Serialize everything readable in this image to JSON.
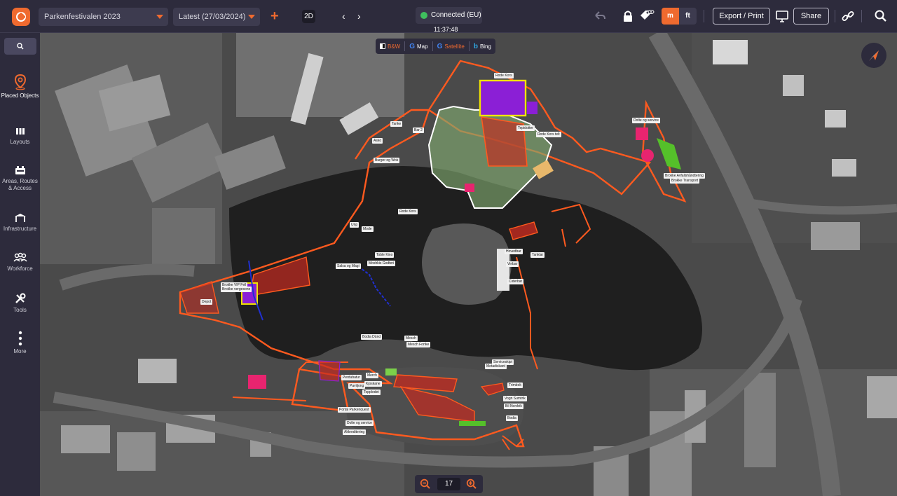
{
  "topbar": {
    "project_select": "Parkenfestivalen 2023",
    "version_select": "Latest (27/03/2024)",
    "view_mode": "2D",
    "connection_status": "Connected (EU)",
    "time": "11:37:48",
    "units": {
      "metric": "m",
      "imperial": "ft",
      "selected": "m"
    },
    "export_label": "Export / Print",
    "share_label": "Share"
  },
  "sidebar": {
    "items": [
      {
        "label": "Placed Objects",
        "icon": "map-pin-icon",
        "active": true
      },
      {
        "label": "Layouts",
        "icon": "layouts-icon"
      },
      {
        "label": "Areas, Routes & Access",
        "icon": "areas-icon"
      },
      {
        "label": "Infrastructure",
        "icon": "infrastructure-icon"
      },
      {
        "label": "Workforce",
        "icon": "workforce-icon"
      },
      {
        "label": "Tools",
        "icon": "tools-icon"
      },
      {
        "label": "More",
        "icon": "more-icon"
      }
    ]
  },
  "map_layers": [
    {
      "label": "B&W",
      "icon": "bw-layer-icon"
    },
    {
      "label": "Map",
      "icon": "google-icon"
    },
    {
      "label": "Satellite",
      "icon": "google-icon",
      "active": true
    },
    {
      "label": "Bing",
      "icon": "bing-icon"
    }
  ],
  "zoom": {
    "level": "17"
  },
  "map_labels": [
    "Rode Kors",
    "Tanke",
    "Bar 2",
    "Asko",
    "Burger og Wok",
    "Rode Kors telt",
    "Tepidotter",
    "Dolte og service",
    "Brokke Avfallshåndtering",
    "Brokke Transport",
    "Rode Kors",
    "Unp",
    "Mode",
    "Toble Kino",
    "Moshkis Godteri",
    "Salsa og Magi",
    "Hovedbar",
    "Tanklar",
    "Vinbar",
    "Ciderbar",
    "Brokke VIP Fell",
    "Brokke vergesone",
    "Depot",
    "Bodia Dünd",
    "Mesch",
    "Mesch Fortke",
    "Merch",
    "Perdubatur",
    "Toppledet",
    "Kjoskane",
    "Paviljong",
    "Portal Parkenquest",
    "Dolte og service",
    "Akkreditering",
    "Serviceskipt",
    "Metadiskant",
    "Trimbok",
    "Vogn Sumtrik",
    "Bil Nordvik",
    "Bodia"
  ],
  "colors": {
    "brand": "#ef6a2f",
    "topbar": "#2d2b3c",
    "zone_orange": "#ff5a1f",
    "zone_red": "#c42a1f",
    "zone_purple": "#8b1fd6",
    "zone_green": "#7fa86e",
    "zone_yellow": "#f0e400",
    "zone_pink": "#e8246f"
  }
}
